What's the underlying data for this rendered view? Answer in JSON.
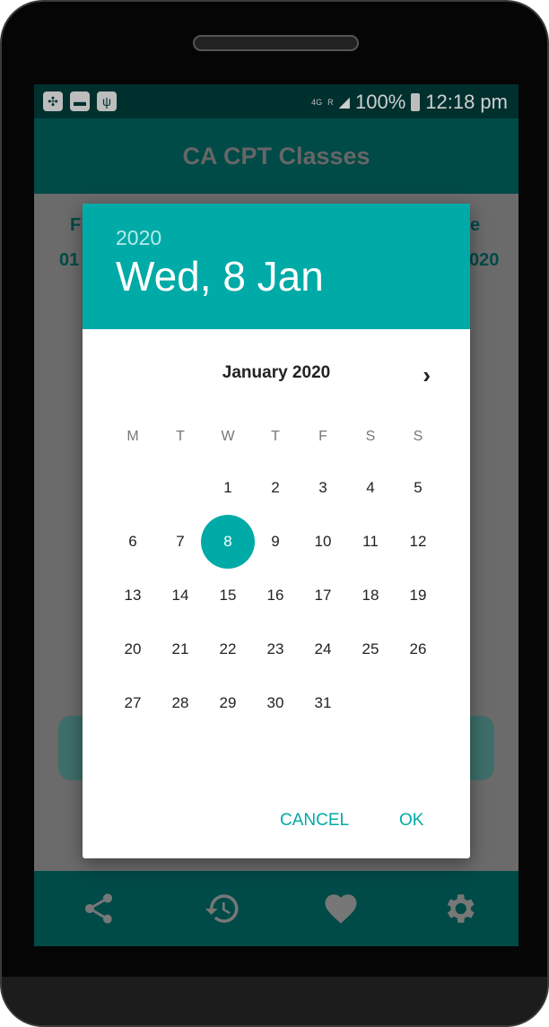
{
  "status": {
    "battery": "100%",
    "time": "12:18 pm",
    "network": "4G",
    "roaming": "R"
  },
  "app": {
    "title": "CA CPT Classes"
  },
  "background_fragments": {
    "left_label": "F",
    "left_value": "01",
    "right_label": "e",
    "right_value": "020"
  },
  "dialog": {
    "year": "2020",
    "date": "Wed, 8 Jan",
    "month": "January 2020",
    "weekdays": [
      "M",
      "T",
      "W",
      "T",
      "F",
      "S",
      "S"
    ],
    "days": [
      "1",
      "2",
      "3",
      "4",
      "5",
      "6",
      "7",
      "8",
      "9",
      "10",
      "11",
      "12",
      "13",
      "14",
      "15",
      "16",
      "17",
      "18",
      "19",
      "20",
      "21",
      "22",
      "23",
      "24",
      "25",
      "26",
      "27",
      "28",
      "29",
      "30",
      "31"
    ],
    "selected_day": "8",
    "first_weekday_index": 2,
    "cancel": "CANCEL",
    "ok": "OK"
  },
  "nav": [
    "share-icon",
    "history-icon",
    "heart-icon",
    "settings-icon"
  ],
  "colors": {
    "accent": "#00aaa6",
    "primary_dark": "#004a47"
  }
}
